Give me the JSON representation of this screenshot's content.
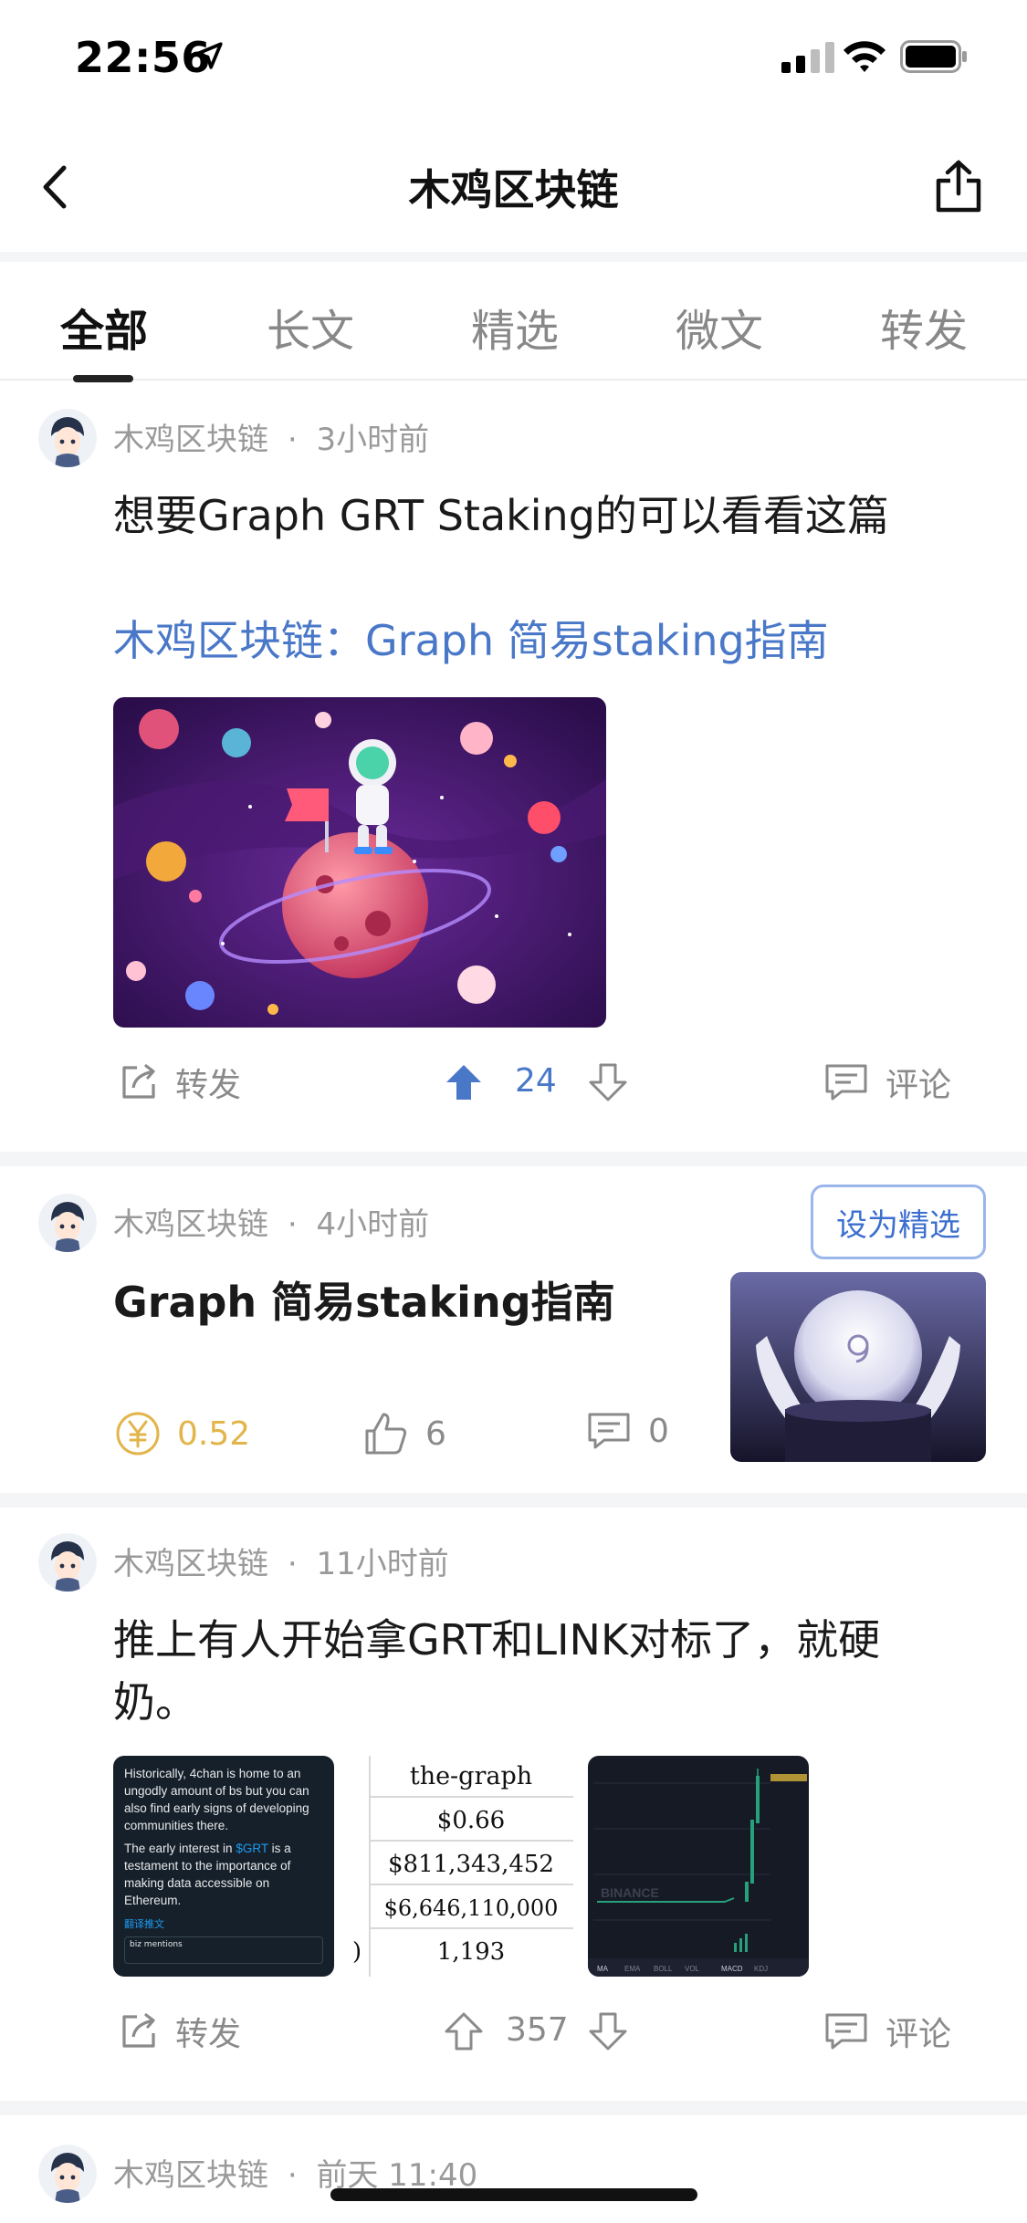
{
  "status_bar": {
    "time": "22:56"
  },
  "nav": {
    "title": "木鸡区块链"
  },
  "tabs": [
    {
      "label": "全部",
      "active": true
    },
    {
      "label": "长文",
      "active": false
    },
    {
      "label": "精选",
      "active": false
    },
    {
      "label": "微文",
      "active": false
    },
    {
      "label": "转发",
      "active": false
    }
  ],
  "posts": [
    {
      "author": "木鸡区块链",
      "separator": "·",
      "time": "3小时前",
      "text": "想要Graph GRT Staking的可以看看这篇",
      "link": "木鸡区块链：Graph 简易staking指南",
      "actions": {
        "repost": "转发",
        "votes": "24",
        "comment": "评论"
      }
    },
    {
      "author": "木鸡区块链",
      "separator": "·",
      "time": "4小时前",
      "feature_button": "设为精选",
      "title": "Graph 简易staking指南",
      "reward": "0.52",
      "likes": "6",
      "comments": "0"
    },
    {
      "author": "木鸡区块链",
      "separator": "·",
      "time": "11小时前",
      "text_line1": "推上有人开始拿GRT和LINK对标了，就硬",
      "text_line2": "奶。",
      "images": {
        "tweet": {
          "para1": "Historically, 4chan is home to an ungodly amount of bs but you can also find early signs of developing communities there.",
          "para2_prefix": "The early interest in ",
          "para2_ticker": "$GRT",
          "para2_suffix": " is a testament to the importance of making data accessible on Ethereum.",
          "translate": "翻译推文",
          "footer": "biz mentions"
        },
        "table": {
          "header": "the-graph",
          "rows": [
            "$0.66",
            "$811,343,452",
            "$6,646,110,000",
            "1,193"
          ],
          "row_prefix": ")"
        },
        "chart": {
          "watermark": "BINANCE",
          "tabs": [
            "MA",
            "EMA",
            "BOLL",
            "VOL",
            "MACD",
            "KDJ"
          ]
        }
      },
      "actions": {
        "repost": "转发",
        "votes": "357",
        "comment": "评论"
      }
    },
    {
      "author": "木鸡区块链",
      "separator": "·",
      "time": "前天 11:40"
    }
  ],
  "colors": {
    "accent_blue": "#4a78c8",
    "reward_gold": "#e2b54a",
    "gap": "#f4f5f7"
  }
}
